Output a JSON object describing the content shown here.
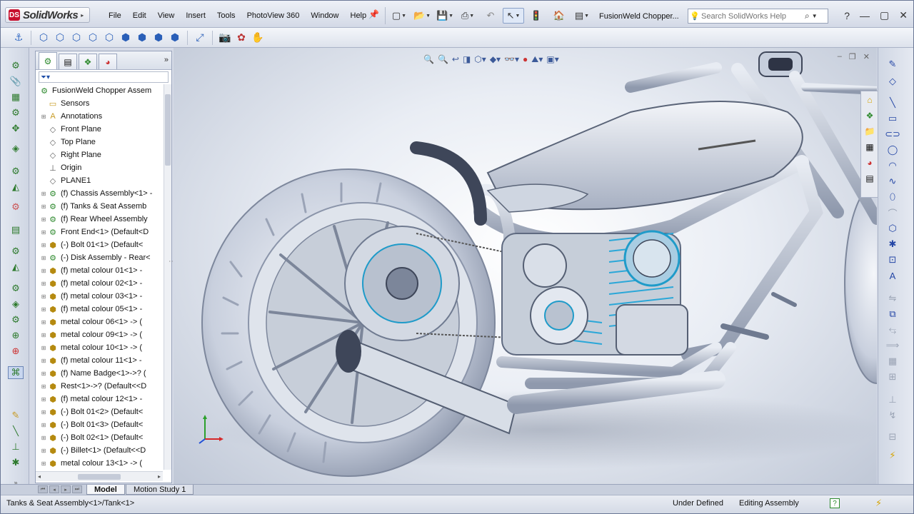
{
  "app": {
    "name": "SolidWorks",
    "document_title": "FusionWeld Chopper..."
  },
  "menu": [
    "File",
    "Edit",
    "View",
    "Insert",
    "Tools",
    "PhotoView 360",
    "Window",
    "Help"
  ],
  "search": {
    "placeholder": "Search SolidWorks Help"
  },
  "feature_tree": {
    "root": "FusionWeld Chopper Assem",
    "items": [
      {
        "label": "Sensors",
        "icon": "folder-icon"
      },
      {
        "label": "Annotations",
        "icon": "annotation-icon"
      },
      {
        "label": "Front Plane",
        "icon": "plane-icon"
      },
      {
        "label": "Top Plane",
        "icon": "plane-icon"
      },
      {
        "label": "Right Plane",
        "icon": "plane-icon"
      },
      {
        "label": "Origin",
        "icon": "origin-icon"
      },
      {
        "label": "PLANE1",
        "icon": "plane-icon"
      },
      {
        "label": "(f) Chassis Assembly<1> -",
        "icon": "assembly-icon"
      },
      {
        "label": "(f) Tanks & Seat Assemb",
        "icon": "assembly-icon"
      },
      {
        "label": "(f) Rear Wheel Assembly",
        "icon": "assembly-icon"
      },
      {
        "label": "Front End<1> (Default<D",
        "icon": "assembly-icon"
      },
      {
        "label": "(-) Bolt 01<1> (Default<",
        "icon": "part-icon"
      },
      {
        "label": "(-) Disk Assembly - Rear<",
        "icon": "assembly-icon"
      },
      {
        "label": "(f) metal colour 01<1> -",
        "icon": "part-icon"
      },
      {
        "label": "(f) metal colour 02<1> -",
        "icon": "part-icon"
      },
      {
        "label": "(f) metal colour 03<1> -",
        "icon": "part-icon"
      },
      {
        "label": "(f) metal colour 05<1> -",
        "icon": "part-icon"
      },
      {
        "label": "metal colour 06<1> -> (",
        "icon": "part-icon"
      },
      {
        "label": "metal colour 09<1> -> (",
        "icon": "part-icon"
      },
      {
        "label": "metal colour 10<1> -> (",
        "icon": "part-icon"
      },
      {
        "label": "(f) metal colour 11<1> -",
        "icon": "part-icon"
      },
      {
        "label": "(f) Name Badge<1>->? (",
        "icon": "part-icon"
      },
      {
        "label": "Rest<1>->? (Default<<D",
        "icon": "part-icon"
      },
      {
        "label": "(f) metal colour 12<1> -",
        "icon": "part-icon"
      },
      {
        "label": "(-) Bolt 01<2> (Default<",
        "icon": "part-icon"
      },
      {
        "label": "(-) Bolt 01<3> (Default<",
        "icon": "part-icon"
      },
      {
        "label": "(-) Bolt 02<1> (Default<",
        "icon": "part-icon"
      },
      {
        "label": "(-) Billet<1> (Default<<D",
        "icon": "part-icon"
      },
      {
        "label": "metal colour 13<1> -> (",
        "icon": "part-icon"
      }
    ]
  },
  "bottom_tabs": [
    "Model",
    "Motion Study 1"
  ],
  "status": {
    "message": "Tanks & Seat Assembly<1>/Tank<1>",
    "definition": "Under Defined",
    "mode": "Editing Assembly",
    "help_glyph": "?"
  },
  "colors": {
    "brand_red": "#c8102e",
    "tree_assembly": "#2f8a2f",
    "tree_part": "#b58a10",
    "toolbar_blue": "#2a5fb8",
    "viewport_bg": "#e9edf4"
  }
}
